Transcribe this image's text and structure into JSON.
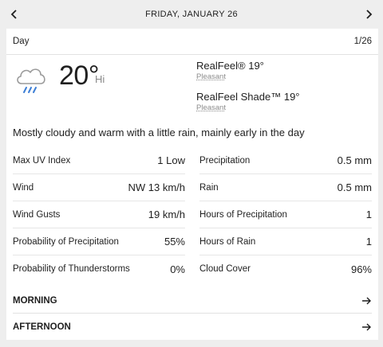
{
  "header": {
    "date": "FRIDAY, JANUARY 26"
  },
  "day_bar": {
    "label": "Day",
    "date_short": "1/26"
  },
  "hero": {
    "temperature": "20°",
    "hi_label": "Hi",
    "icon": "cloud-rain-icon",
    "realfeel": {
      "label": "RealFeel® 19°",
      "sub": "Pleasant"
    },
    "realfeel_shade": {
      "label": "RealFeel Shade™ 19°",
      "sub": "Pleasant"
    }
  },
  "summary": "Mostly cloudy and warm with a little rain, mainly early in the day",
  "details": {
    "left": [
      {
        "label": "Max UV Index",
        "value": "1 Low"
      },
      {
        "label": "Wind",
        "value": "NW 13 km/h"
      },
      {
        "label": "Wind Gusts",
        "value": "19 km/h"
      },
      {
        "label": "Probability of Precipitation",
        "value": "55%"
      },
      {
        "label": "Probability of Thunderstorms",
        "value": "0%"
      }
    ],
    "right": [
      {
        "label": "Precipitation",
        "value": "0.5 mm"
      },
      {
        "label": "Rain",
        "value": "0.5 mm"
      },
      {
        "label": "Hours of Precipitation",
        "value": "1"
      },
      {
        "label": "Hours of Rain",
        "value": "1"
      },
      {
        "label": "Cloud Cover",
        "value": "96%"
      }
    ]
  },
  "sections": [
    {
      "label": "MORNING"
    },
    {
      "label": "AFTERNOON"
    }
  ],
  "colors": {
    "rain_drop": "#3d7fd6",
    "cloud_outline": "#9a9a9a"
  }
}
